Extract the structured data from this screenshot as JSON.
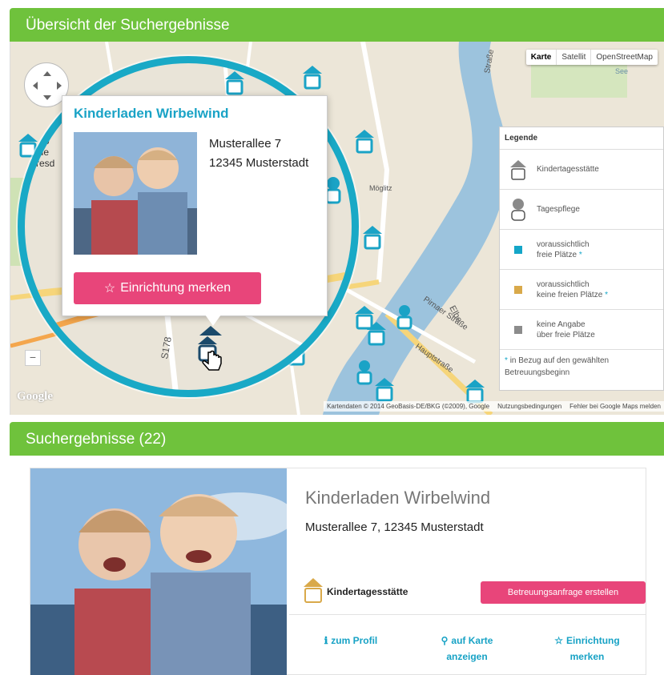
{
  "map_section": {
    "title": "Übersicht der Suchergebnisse",
    "map_type_buttons": [
      "Karte",
      "Satellit",
      "OpenStreetMap"
    ],
    "street_labels": [
      "Straße",
      "Möglitz",
      "Elbe",
      "Pirnaer Straße",
      "Hauptstraße",
      "S178",
      "See"
    ],
    "partial_labels": [
      "Mo",
      "ide",
      "resd"
    ],
    "zoom_minus": "−",
    "google_logo": "Google",
    "attribution": {
      "data": "Kartendaten © 2014 GeoBasis-DE/BKG (©2009), Google",
      "terms": "Nutzungsbedingungen",
      "report": "Fehler bei Google Maps melden"
    },
    "legend": {
      "title": "Legende",
      "items": [
        {
          "label": "Kindertagesstätte",
          "icon": "house-icon"
        },
        {
          "label": "Tagespflege",
          "icon": "person-icon"
        },
        {
          "label_line1": "voraussichtlich",
          "label_line2": "freie Plätze",
          "marker": "*",
          "color": "#14a6c8"
        },
        {
          "label_line1": "voraussichtlich",
          "label_line2": "keine freien Plätze",
          "marker": "*",
          "color": "#d9a94a"
        },
        {
          "label_line1": "keine Angabe",
          "label_line2": "über freie Plätze",
          "color": "#8c8c8c"
        }
      ],
      "note_marker": "*",
      "note": "in Bezug auf den gewählten Betreuungsbeginn"
    },
    "popup": {
      "title": "Kinderladen Wirbelwind",
      "address_line1": "Musterallee 7",
      "address_line2": "12345 Musterstadt",
      "button_icon": "☆",
      "button_label": "Einrichtung merken"
    }
  },
  "results_section": {
    "title": "Suchergebnisse (22)",
    "result": {
      "name": "Kinderladen Wirbelwind",
      "address": "Musterallee 7, 12345 Musterstadt",
      "type_label": "Kindertagesstätte",
      "request_button": "Betreuungsanfrage erstellen",
      "actions": [
        {
          "icon": "ℹ",
          "line1": "zum Profil",
          "line2": ""
        },
        {
          "icon": "⚲",
          "line1": "auf Karte",
          "line2": "anzeigen"
        },
        {
          "icon": "☆",
          "line1": "Einrichtung",
          "line2": "merken"
        }
      ]
    }
  },
  "colors": {
    "header_green": "#6fc23c",
    "accent_teal": "#19a9c6",
    "button_pink": "#e8457a",
    "status_free": "#14a6c8",
    "status_none": "#d9a94a",
    "status_unknown": "#8c8c8c"
  }
}
